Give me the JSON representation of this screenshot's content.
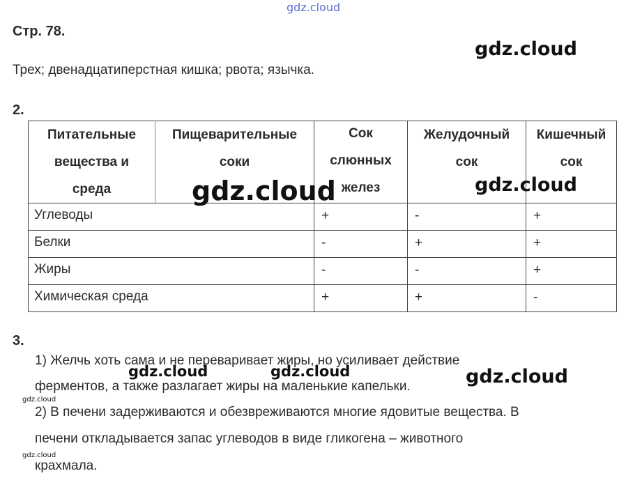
{
  "watermarks": {
    "top": "gdz.cloud",
    "main": "gdz.cloud",
    "small": "gdz.cloud"
  },
  "page": {
    "title": "Стр. 78.",
    "answer1": "Трех; двенадцатиперстная кишка; рвота; язычка."
  },
  "section2": {
    "number": "2.",
    "table": {
      "headers": {
        "col1": [
          "Питательные",
          "вещества и",
          "среда"
        ],
        "col2": [
          "Пищеварительные",
          "соки"
        ],
        "col3": [
          "Сок",
          "слюнных",
          "желез"
        ],
        "col4": [
          "Желудочный",
          "сок"
        ],
        "col5": [
          "Кишечный",
          "сок"
        ]
      },
      "rows": [
        {
          "label": "Углеводы",
          "saliva": "+",
          "gastric": "-",
          "intestinal": "+"
        },
        {
          "label": "Белки",
          "saliva": "-",
          "gastric": "+",
          "intestinal": "+"
        },
        {
          "label": "Жиры",
          "saliva": "-",
          "gastric": "-",
          "intestinal": "+"
        },
        {
          "label": "Химическая среда",
          "saliva": "+",
          "gastric": "+",
          "intestinal": "-"
        }
      ]
    }
  },
  "section3": {
    "number": "3.",
    "lines": [
      "1) Желчь хоть сама и не переваривает жиры, но усиливает действие",
      "ферментов, а также разлагает жиры на маленькие капельки.",
      "2) В печени задерживаются и обезвреживаются многие ядовитые вещества. В",
      "печени откладывается запас углеводов в виде гликогена – животного",
      "крахмала."
    ]
  }
}
